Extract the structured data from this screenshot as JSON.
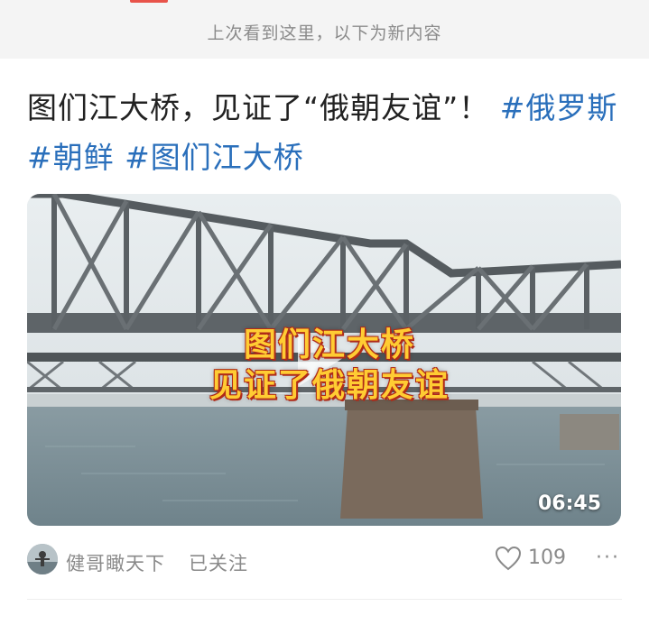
{
  "feed": {
    "read_divider": "上次看到这里，以下为新内容"
  },
  "post": {
    "title_text": "图们江大桥，见证了“俄朝友谊”！ ",
    "hashtags": [
      "#俄罗斯",
      "#朝鲜",
      "#图们江大桥"
    ],
    "video": {
      "overlay_line1": "图们江大桥",
      "overlay_line2": "见证了俄朝友谊",
      "duration": "06:45"
    },
    "author": {
      "name": "健哥瞰天下",
      "follow_status": "已关注"
    },
    "likes": "109",
    "more_icon": "ellipsis-icon",
    "like_icon": "heart-icon"
  },
  "colors": {
    "hashtag": "#2a6fbb",
    "overlay_text": "#ffcc33"
  }
}
